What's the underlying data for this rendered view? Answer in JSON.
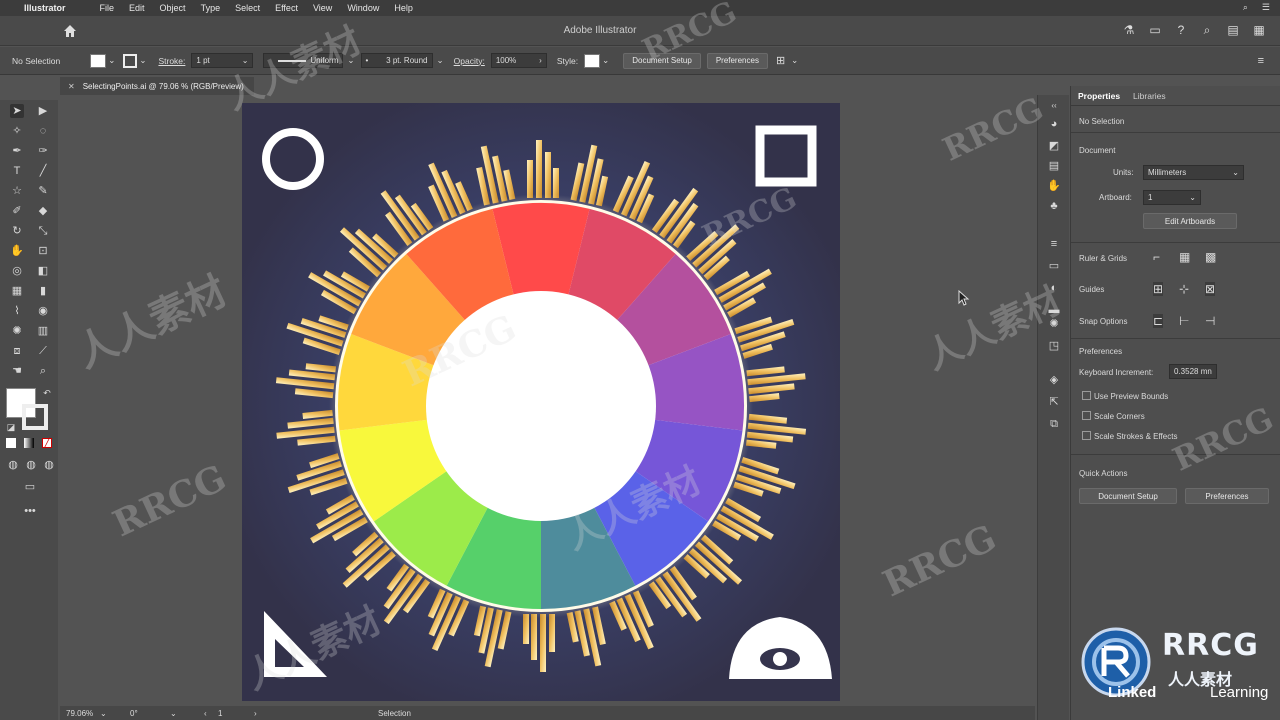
{
  "menubar": {
    "app_name": "Illustrator",
    "items": [
      "File",
      "Edit",
      "Object",
      "Type",
      "Select",
      "Effect",
      "View",
      "Window",
      "Help"
    ]
  },
  "appbar": {
    "title": "Adobe Illustrator"
  },
  "controlbar": {
    "selection": "No Selection",
    "stroke_label": "Stroke:",
    "stroke_value": "1 pt",
    "stroke_profile": "Uniform",
    "brush": "3 pt. Round",
    "opacity_label": "Opacity:",
    "opacity_value": "100%",
    "style_label": "Style:",
    "document_setup": "Document Setup",
    "preferences": "Preferences"
  },
  "doctab": {
    "title": "SelectingPoints.ai @ 79.06 % (RGB/Preview)"
  },
  "properties": {
    "tabs": [
      "Properties",
      "Libraries"
    ],
    "no_selection": "No Selection",
    "document_heading": "Document",
    "units_label": "Units:",
    "units_value": "Millimeters",
    "artboard_label": "Artboard:",
    "artboard_value": "1",
    "edit_artboards": "Edit Artboards",
    "ruler_grids": "Ruler & Grids",
    "guides": "Guides",
    "snap_options": "Snap Options",
    "preferences_heading": "Preferences",
    "keyboard_increment_label": "Keyboard Increment:",
    "keyboard_increment_value": "0.3528 mn",
    "checkboxes": [
      "Use Preview Bounds",
      "Scale Corners",
      "Scale Strokes & Effects"
    ],
    "quick_actions": "Quick Actions",
    "qa_document_setup": "Document Setup",
    "qa_preferences": "Preferences"
  },
  "statusbar": {
    "zoom": "79.06%",
    "rotation": "0°",
    "artboard": "1",
    "tool": "Selection"
  },
  "artwork": {
    "wheel_colors": [
      "#ff4a4a",
      "#e04a66",
      "#b4509e",
      "#9654c4",
      "#7656d8",
      "#5a62e8",
      "#4e8c9c",
      "#56d06a",
      "#9ceb4a",
      "#f8f83c",
      "#ffd83c",
      "#ffa83c",
      "#ff6a3c"
    ],
    "accent_gold": "#f0c060"
  },
  "watermarks": {
    "brand": "RRCG",
    "cn": "人人素材",
    "linkedin": "Linked",
    "learning": "Learning",
    "footer_cn": "人人素材"
  }
}
